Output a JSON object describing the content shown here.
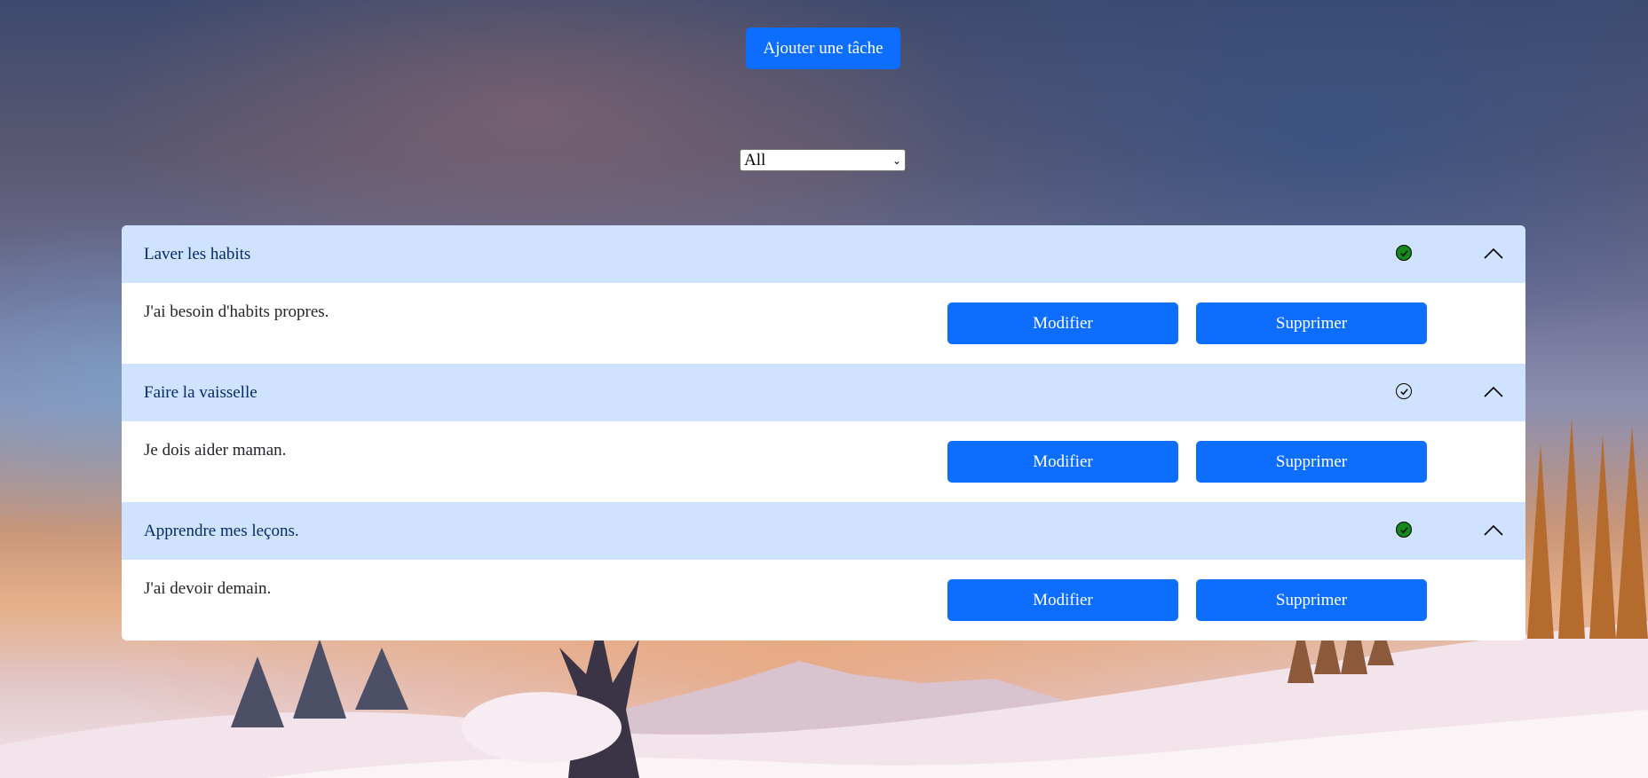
{
  "add_button_label": "Ajouter une tâche",
  "filter": {
    "selected": "All"
  },
  "tasks": [
    {
      "title": "Laver les habits",
      "description": "J'ai besoin d'habits propres.",
      "completed": true,
      "edit_label": "Modifier",
      "delete_label": "Supprimer"
    },
    {
      "title": "Faire la vaisselle",
      "description": "Je dois aider maman.",
      "completed": false,
      "edit_label": "Modifier",
      "delete_label": "Supprimer"
    },
    {
      "title": "Apprendre mes leçons.",
      "description": "J'ai devoir demain.",
      "completed": true,
      "edit_label": "Modifier",
      "delete_label": "Supprimer"
    }
  ],
  "colors": {
    "primary": "#0d6efd",
    "header_bg": "#cfe2ff",
    "done_check": "#138a1c"
  },
  "icons": {
    "check": "check-circle-icon",
    "collapse": "chevron-up-icon",
    "dropdown": "chevron-down-icon"
  }
}
